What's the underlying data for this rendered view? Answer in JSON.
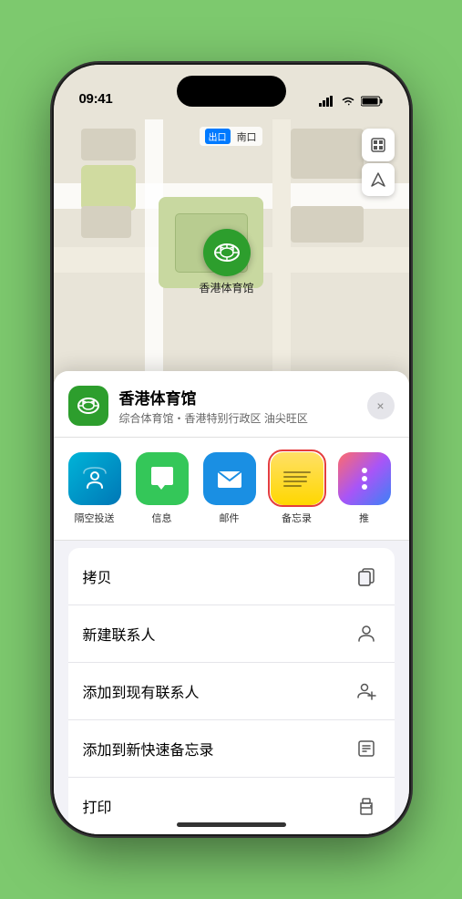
{
  "status_bar": {
    "time": "09:41",
    "location_icon": "▸",
    "signal_bars": "▐▐▐",
    "wifi_icon": "wifi",
    "battery_icon": "battery"
  },
  "map": {
    "label_prefix": "南口",
    "stadium_name": "香港体育馆",
    "map_type_icon": "map",
    "location_icon": "location"
  },
  "sheet": {
    "venue_name": "香港体育馆",
    "venue_sub": "综合体育馆・香港特别行政区 油尖旺区",
    "close_label": "×"
  },
  "share_items": [
    {
      "id": "airdrop",
      "label": "隔空投送",
      "style": "airdrop"
    },
    {
      "id": "message",
      "label": "信息",
      "style": "message"
    },
    {
      "id": "mail",
      "label": "邮件",
      "style": "mail"
    },
    {
      "id": "notes",
      "label": "备忘录",
      "style": "notes"
    },
    {
      "id": "more",
      "label": "推",
      "style": "more"
    }
  ],
  "actions": [
    {
      "id": "copy",
      "label": "拷贝",
      "icon": "copy"
    },
    {
      "id": "new-contact",
      "label": "新建联系人",
      "icon": "person"
    },
    {
      "id": "add-to-contact",
      "label": "添加到现有联系人",
      "icon": "person-add"
    },
    {
      "id": "quick-note",
      "label": "添加到新快速备忘录",
      "icon": "note"
    },
    {
      "id": "print",
      "label": "打印",
      "icon": "printer"
    }
  ]
}
